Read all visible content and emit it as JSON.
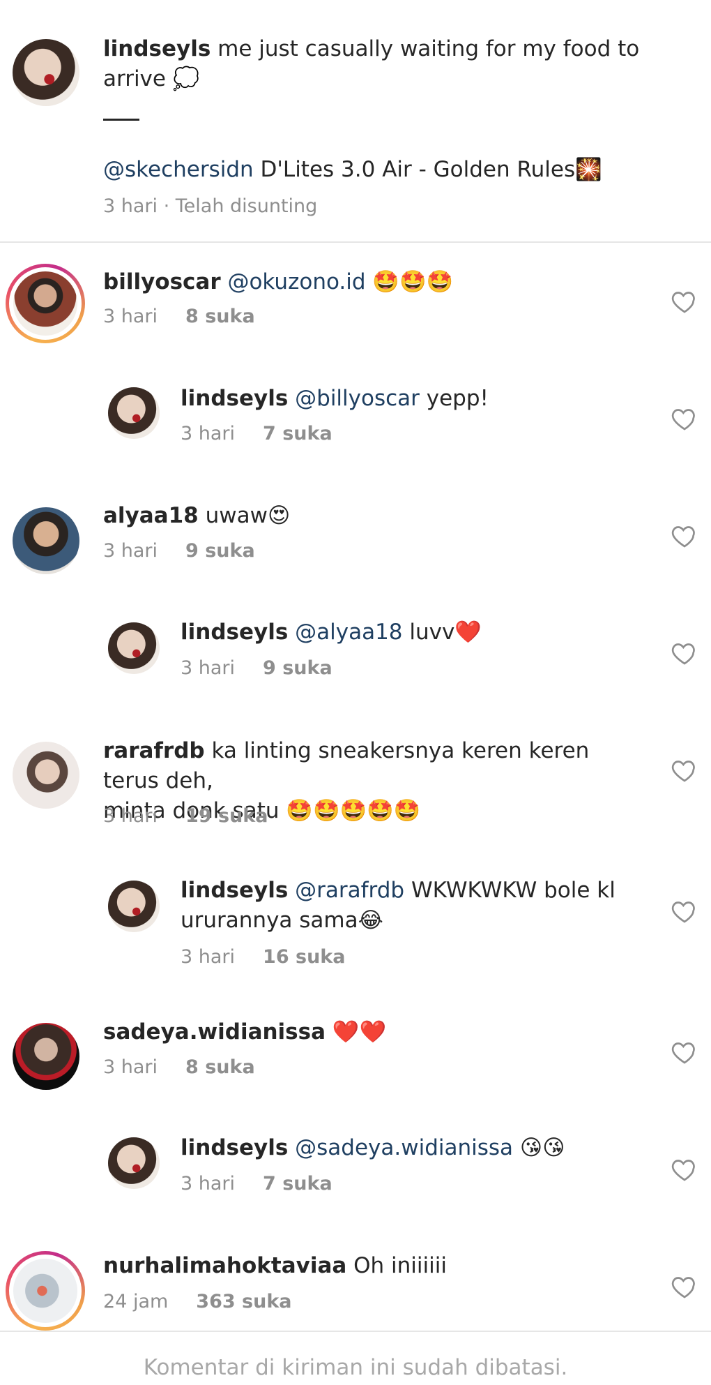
{
  "caption": {
    "username": "lindseyls",
    "text": "me just casually waiting for my food to arrive 💭",
    "separator": "___",
    "mention": "@skechersidn",
    "mention_text": "D'Lites 3.0 Air - Golden Rules🎇",
    "meta": "3 hari · Telah disunting"
  },
  "comments": [
    {
      "username": "billyoscar",
      "mention": "@okuzono.id",
      "text": "🤩🤩🤩",
      "time": "3 hari",
      "likes": "8 suka"
    },
    {
      "username": "lindseyls",
      "mention": "@billyoscar",
      "text": "yepp!",
      "time": "3 hari",
      "likes": "7 suka"
    },
    {
      "username": "alyaa18",
      "mention": "",
      "text": "uwaw😍",
      "time": "3 hari",
      "likes": "9 suka"
    },
    {
      "username": "lindseyls",
      "mention": "@alyaa18",
      "text": "luvv❤️",
      "time": "3 hari",
      "likes": "9 suka"
    },
    {
      "username": "rarafrdb",
      "mention": "",
      "text": "ka linting sneakersnya keren keren terus deh,",
      "text2": "minta donk satu 🤩🤩🤩🤩🤩",
      "time": "3 hari",
      "likes": "19 suka"
    },
    {
      "username": "lindseyls",
      "mention": "@rarafrdb",
      "text": "WKWKWKW bole kl",
      "text2": "ururannya sama😂",
      "time": "3 hari",
      "likes": "16 suka"
    },
    {
      "username": "sadeya.widianissa",
      "mention": "",
      "text": "❤️❤️",
      "time": "3 hari",
      "likes": "8 suka"
    },
    {
      "username": "lindseyls",
      "mention": "@sadeya.widianissa",
      "text": "😘😘",
      "time": "3 hari",
      "likes": "7 suka"
    },
    {
      "username": "nurhalimahoktaviaa",
      "mention": "",
      "text": "Oh iniiiiii",
      "time": "24 jam",
      "likes": "363 suka"
    }
  ],
  "footer": "Komentar di kiriman ini sudah dibatasi.",
  "icons": {
    "like": "heart-outline-icon"
  }
}
